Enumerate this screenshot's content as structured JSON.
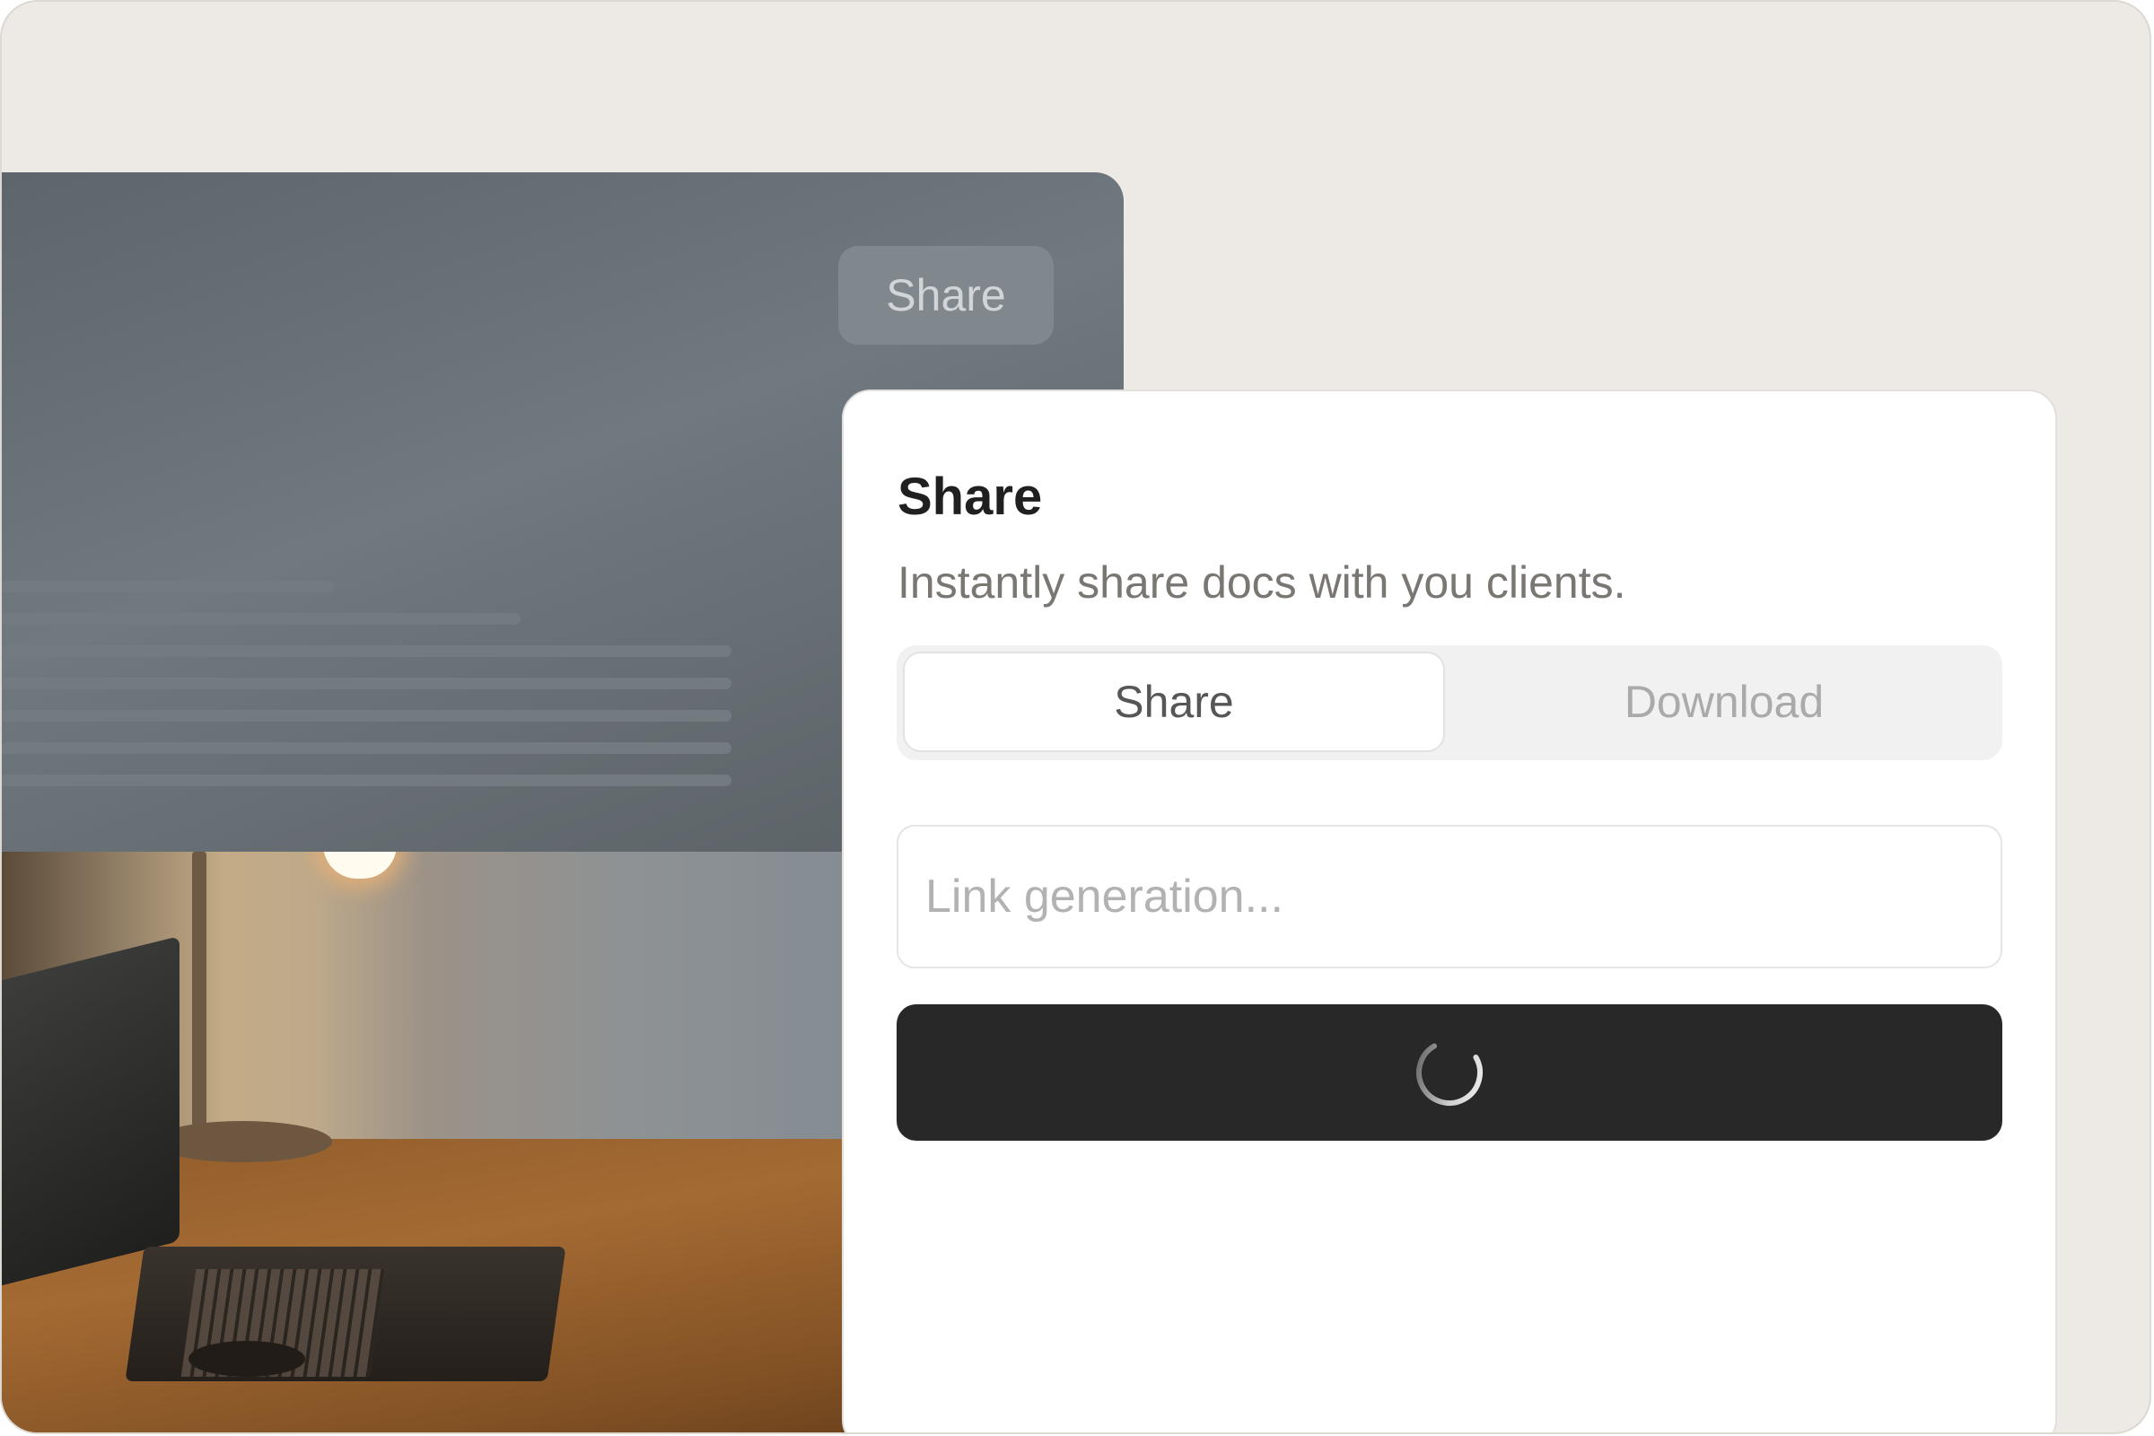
{
  "background_document": {
    "share_button_label": "Share"
  },
  "share_dialog": {
    "title": "Share",
    "subtitle": "Instantly share docs with you clients.",
    "tabs": [
      {
        "label": "Share",
        "selected": true
      },
      {
        "label": "Download",
        "selected": false
      }
    ],
    "link_input": {
      "value": "",
      "placeholder": "Link generation..."
    },
    "submit_button": {
      "state": "loading",
      "icon": "spinner-icon"
    }
  },
  "colors": {
    "frame_background": "#edeae5",
    "primary_button": "#282828",
    "title_text": "#202020",
    "muted_text": "#7a7773"
  }
}
